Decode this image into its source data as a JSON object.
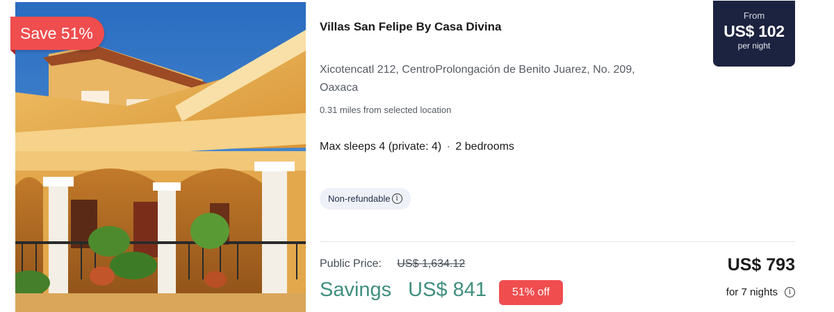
{
  "listing": {
    "save_badge": "Save 51%",
    "title": "Villas San Felipe By Casa Divina",
    "address_line1": "Xicotencatl 212, CentroProlongación de Benito Juarez, No. 209,",
    "address_line2": "Oaxaca",
    "distance": "0.31 miles from selected location",
    "sleeps": "Max sleeps 4 (private: 4)",
    "sleeps_separator": "·",
    "bedrooms": "2 bedrooms",
    "refund_policy": "Non-refundable",
    "info_glyph": "i"
  },
  "price_tag": {
    "from_label": "From",
    "amount": "US$ 102",
    "per_label": "per night"
  },
  "pricing": {
    "public_price_label": "Public Price:",
    "public_price_value": "US$ 1,634.12",
    "savings_label": "Savings",
    "savings_value": "US$ 841",
    "off_badge": "51% off",
    "total": "US$ 793",
    "nights": "for 7 nights"
  },
  "colors": {
    "accent_red": "#f04d4f",
    "savings_green": "#3f8f7f",
    "price_tag_bg": "#1c2340"
  },
  "icons": [
    "info-icon"
  ]
}
